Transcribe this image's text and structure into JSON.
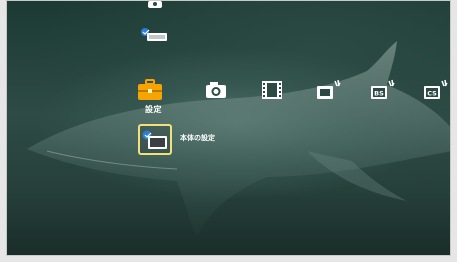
{
  "category_bar": {
    "selected_index": 0,
    "selected_label": "設定",
    "items": [
      {
        "icon": "toolbox-icon",
        "selected": true
      },
      {
        "icon": "camera-icon",
        "selected": false
      },
      {
        "icon": "film-icon",
        "selected": false
      },
      {
        "icon": "tv-broadcast-icon",
        "selected": false
      },
      {
        "icon": "bs-broadcast-icon",
        "badge": "BS",
        "selected": false
      },
      {
        "icon": "cs-broadcast-icon",
        "badge": "CS",
        "selected": false
      }
    ]
  },
  "settings_menu": {
    "items": [
      {
        "icon": "main-unit-settings-icon",
        "label": "本体の設定",
        "selected": true
      }
    ]
  },
  "colors": {
    "accent_selected": "#f5a400",
    "focus_border": "#f1e17a",
    "icon_default": "#ffffff"
  }
}
